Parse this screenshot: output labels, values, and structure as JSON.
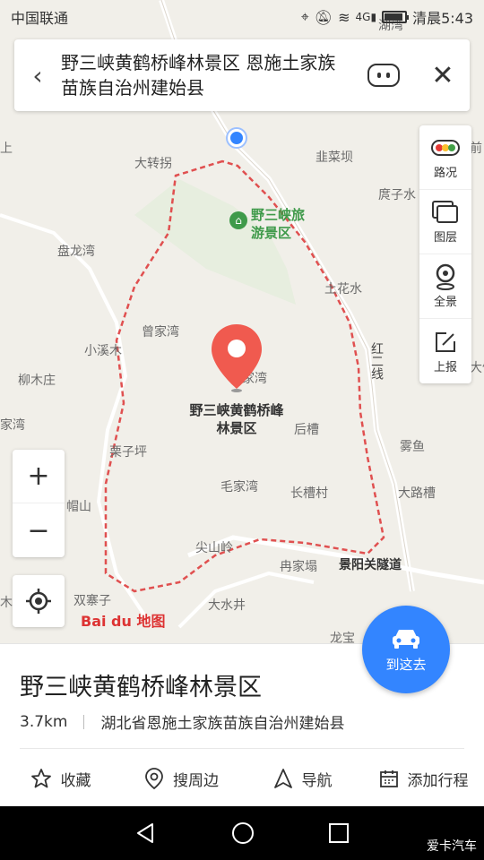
{
  "status_bar": {
    "carrier": "中国联通",
    "time": "清晨5:43",
    "battery_level": 0.9
  },
  "search": {
    "query": "野三峡黄鹤桥峰林景区 恩施土家族苗族自治州建始县"
  },
  "toolbar": {
    "items": [
      {
        "label": "路况",
        "icon": "traffic-light-icon"
      },
      {
        "label": "图层",
        "icon": "layers-icon"
      },
      {
        "label": "全景",
        "icon": "panorama-icon"
      },
      {
        "label": "上报",
        "icon": "report-icon"
      }
    ]
  },
  "map": {
    "places": [
      {
        "label": "大转拐"
      },
      {
        "label": "韭菜坝"
      },
      {
        "label": "庹子水"
      },
      {
        "label": "盘龙湾"
      },
      {
        "label": "土花水"
      },
      {
        "label": "曾家湾"
      },
      {
        "label": "小溪木"
      },
      {
        "label": "柳木庄"
      },
      {
        "label": "家湾"
      },
      {
        "label": "后槽"
      },
      {
        "label": "雾鱼"
      },
      {
        "label": "栗子坪"
      },
      {
        "label": "毛家湾"
      },
      {
        "label": "长槽村"
      },
      {
        "label": "大路槽"
      },
      {
        "label": "帽山"
      },
      {
        "label": "尖山岭"
      },
      {
        "label": "冉家塌"
      },
      {
        "label": "双寨子"
      },
      {
        "label": "大水井"
      },
      {
        "label": "家湾"
      },
      {
        "label": "上"
      },
      {
        "label": "前"
      },
      {
        "label": "大竹"
      },
      {
        "label": "木"
      },
      {
        "label": "龙宝"
      },
      {
        "label": "湖湾"
      }
    ],
    "scenic_label": "野三峡旅游景区",
    "marker_label": "野三峡黄鹤桥峰林景区",
    "road_labels": [
      "红二线",
      "景阳关隧道"
    ],
    "logo": "Bai du 地图"
  },
  "zoom": {
    "in": "+",
    "out": "−"
  },
  "route_button": {
    "label": "到这去",
    "icon": "car-icon"
  },
  "poi": {
    "name": "野三峡黄鹤桥峰林景区",
    "distance": "3.7km",
    "address": "湖北省恩施土家族苗族自治州建始县"
  },
  "actions": [
    {
      "label": "收藏",
      "icon": "star-icon"
    },
    {
      "label": "搜周边",
      "icon": "location-pin-icon"
    },
    {
      "label": "导航",
      "icon": "navigation-arrow-icon"
    },
    {
      "label": "添加行程",
      "icon": "calendar-icon"
    }
  ],
  "watermark": "爱卡汽车",
  "colors": {
    "accent": "#3385ff",
    "boundary": "#e05050",
    "scenic": "#3f9a4a"
  }
}
